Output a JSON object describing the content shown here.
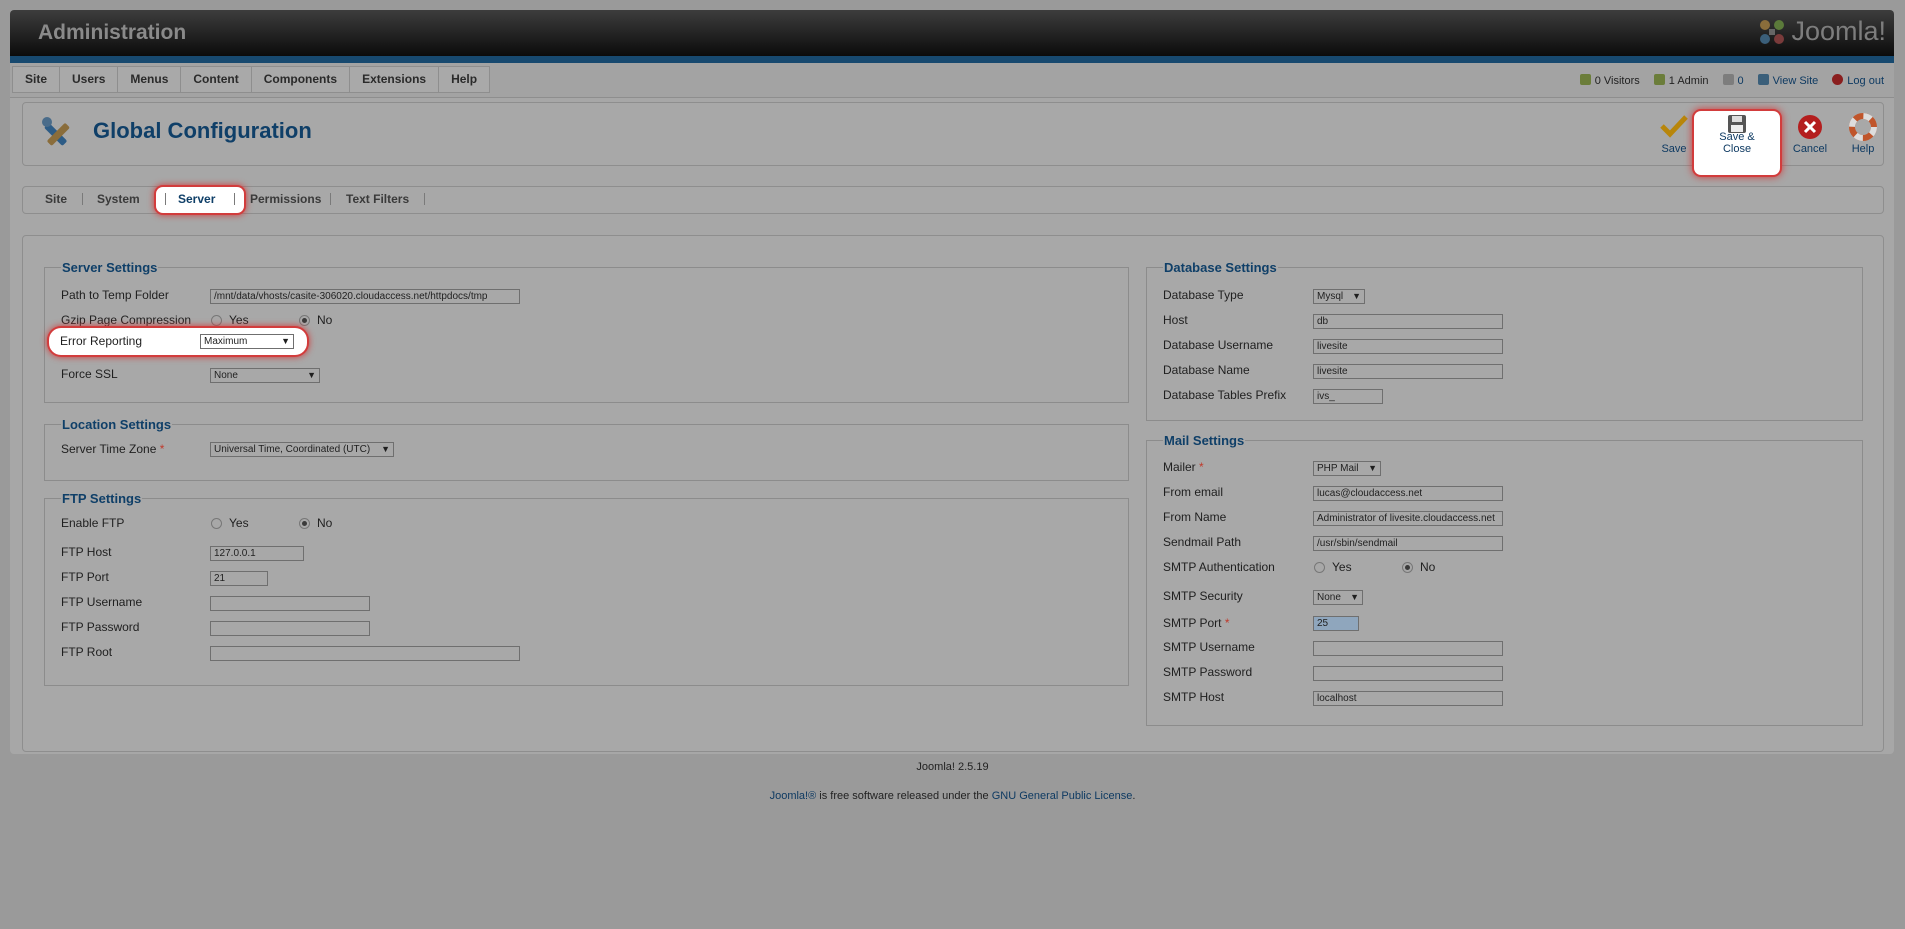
{
  "header": {
    "title": "Administration",
    "logo_text": "Joomla!"
  },
  "menu": [
    "Site",
    "Users",
    "Menus",
    "Content",
    "Components",
    "Extensions",
    "Help"
  ],
  "status": {
    "visitors": "0 Visitors",
    "admins": "1 Admin",
    "messages": "0",
    "view_site": "View Site",
    "logout": "Log out"
  },
  "toolbar": {
    "title": "Global Configuration",
    "save": "Save",
    "save_close": "Save & Close",
    "cancel": "Cancel",
    "help": "Help"
  },
  "tabs": [
    "Site",
    "System",
    "Server",
    "Permissions",
    "Text Filters"
  ],
  "active_tab": "Server",
  "server": {
    "legend": "Server Settings",
    "temp_label": "Path to Temp Folder",
    "temp_value": "/mnt/data/vhosts/casite-306020.cloudaccess.net/httpdocs/tmp",
    "gzip_label": "Gzip Page Compression",
    "yes": "Yes",
    "no": "No",
    "gzip_selected": "No",
    "error_label": "Error Reporting",
    "error_value": "Maximum",
    "ssl_label": "Force SSL",
    "ssl_value": "None"
  },
  "location": {
    "legend": "Location Settings",
    "tz_label": "Server Time Zone",
    "tz_value": "Universal Time, Coordinated (UTC)"
  },
  "ftp": {
    "legend": "FTP Settings",
    "enable_label": "Enable FTP",
    "enable_selected": "No",
    "host_label": "FTP Host",
    "host_value": "127.0.0.1",
    "port_label": "FTP Port",
    "port_value": "21",
    "user_label": "FTP Username",
    "user_value": "",
    "pass_label": "FTP Password",
    "pass_value": "",
    "root_label": "FTP Root",
    "root_value": ""
  },
  "database": {
    "legend": "Database Settings",
    "type_label": "Database Type",
    "type_value": "Mysql",
    "host_label": "Host",
    "host_value": "db",
    "user_label": "Database Username",
    "user_value": "livesite",
    "name_label": "Database Name",
    "name_value": "livesite",
    "prefix_label": "Database Tables Prefix",
    "prefix_value": "ivs_"
  },
  "mail": {
    "legend": "Mail Settings",
    "mailer_label": "Mailer",
    "mailer_value": "PHP Mail",
    "from_email_label": "From email",
    "from_email_value": "lucas@cloudaccess.net",
    "from_name_label": "From Name",
    "from_name_value": "Administrator of livesite.cloudaccess.net",
    "sendmail_label": "Sendmail Path",
    "sendmail_value": "/usr/sbin/sendmail",
    "smtp_auth_label": "SMTP Authentication",
    "smtp_auth_selected": "No",
    "smtp_sec_label": "SMTP Security",
    "smtp_sec_value": "None",
    "smtp_port_label": "SMTP Port",
    "smtp_port_value": "25",
    "smtp_user_label": "SMTP Username",
    "smtp_user_value": "",
    "smtp_pass_label": "SMTP Password",
    "smtp_pass_value": "",
    "smtp_host_label": "SMTP Host",
    "smtp_host_value": "localhost"
  },
  "footer": {
    "version": "Joomla! 2.5.19",
    "link1": "Joomla!®",
    "text": " is free software released under the ",
    "link2": "GNU General Public License",
    "end": "."
  },
  "colors": {
    "accent_blue": "#0f3f68",
    "highlight_red": "#d23c3c",
    "header_blue": "#17496f"
  }
}
